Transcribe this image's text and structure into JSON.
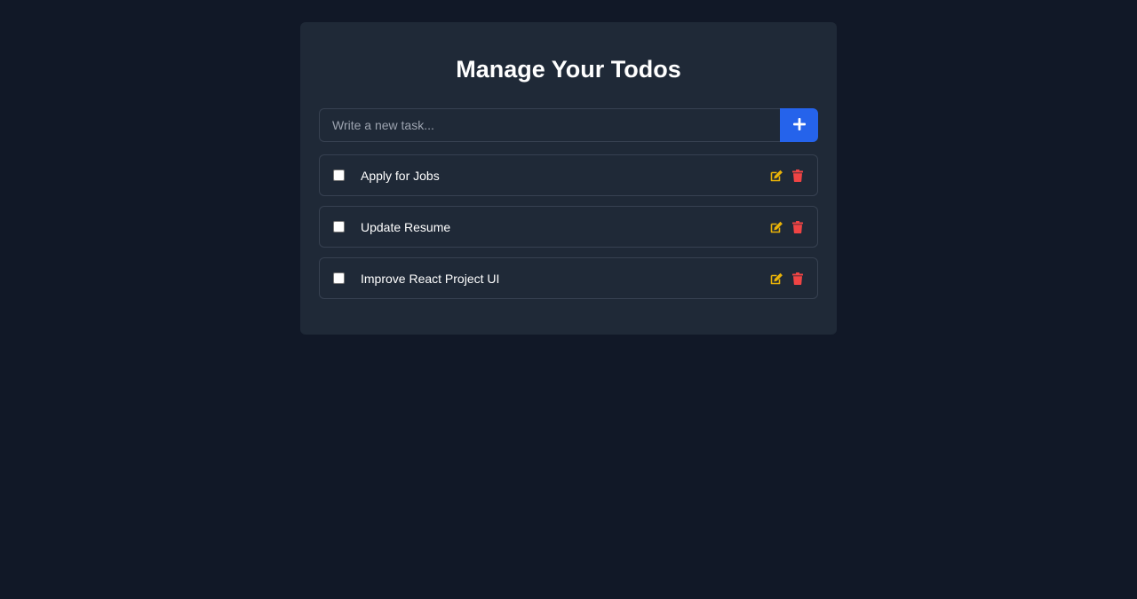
{
  "header": {
    "title": "Manage Your Todos"
  },
  "add_form": {
    "placeholder": "Write a new task...",
    "value": "",
    "button_icon": "plus-icon"
  },
  "todos": [
    {
      "text": "Apply for Jobs",
      "completed": false
    },
    {
      "text": "Update Resume",
      "completed": false
    },
    {
      "text": "Improve React Project UI",
      "completed": false
    }
  ],
  "icons": {
    "edit": "edit-icon",
    "delete": "trash-icon"
  },
  "colors": {
    "background": "#111827",
    "card": "#1f2937",
    "accent": "#2563eb",
    "edit": "#eab308",
    "delete": "#ef4444"
  }
}
